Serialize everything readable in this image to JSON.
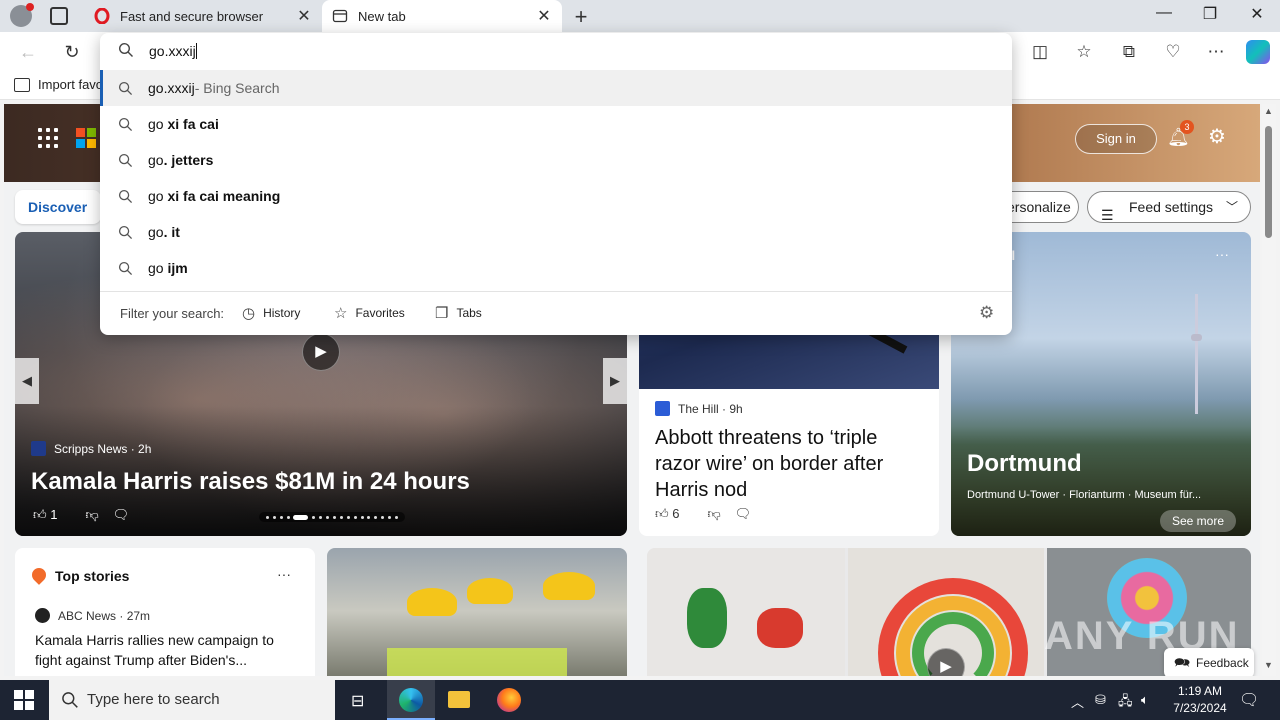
{
  "browser": {
    "tabs": [
      {
        "title": "Fast and secure browser",
        "favicon": "opera-icon"
      },
      {
        "title": "New tab",
        "favicon": "newtab-icon"
      }
    ]
  },
  "favorites_bar": {
    "import_label": "Import favo"
  },
  "omnibox": {
    "query": "go.xxxij",
    "suggestions": [
      {
        "prefix": "go.xxxij",
        "bold": "",
        "suffix": " - Bing Search"
      },
      {
        "prefix": "go ",
        "bold": "xi fa cai",
        "suffix": ""
      },
      {
        "prefix": "go",
        "bold": ". jetters",
        "suffix": ""
      },
      {
        "prefix": "go ",
        "bold": "xi fa cai meaning",
        "suffix": ""
      },
      {
        "prefix": "go",
        "bold": ". it",
        "suffix": ""
      },
      {
        "prefix": "go ",
        "bold": "ijm",
        "suffix": ""
      }
    ],
    "filter_label": "Filter your search:",
    "filters": [
      "History",
      "Favorites",
      "Tabs"
    ]
  },
  "msn": {
    "sign_in": "Sign in",
    "notification_count": "3",
    "discover_tab": "Discover",
    "personalize": "ersonalize",
    "feed_settings": "Feed settings",
    "hero": {
      "source": "Scripps News",
      "age": "2h",
      "headline": "Kamala Harris raises $81M in 24 hours",
      "likes": "1"
    },
    "card2": {
      "source": "The Hill",
      "age": "9h",
      "headline": "Abbott threatens to ‘triple razor wire’ on border after Harris nod",
      "likes": "6"
    },
    "travel": {
      "category": "vel",
      "title": "Dortmund",
      "subtitle": "Dortmund U-Tower · Florianturm · Museum für...",
      "see_more": "See more"
    },
    "top_stories": {
      "heading": "Top stories",
      "source": "ABC News",
      "age": "27m",
      "headline": "Kamala Harris rallies new campaign to fight against Trump after Biden's..."
    },
    "feedback": "Feedback",
    "watermark": "ANY RUN"
  },
  "taskbar": {
    "search_placeholder": "Type here to search",
    "time": "1:19 AM",
    "date": "7/23/2024"
  },
  "colors": {
    "accent": "#1a5fb4",
    "taskbar": "#1d2433",
    "badge": "#e3541f"
  }
}
